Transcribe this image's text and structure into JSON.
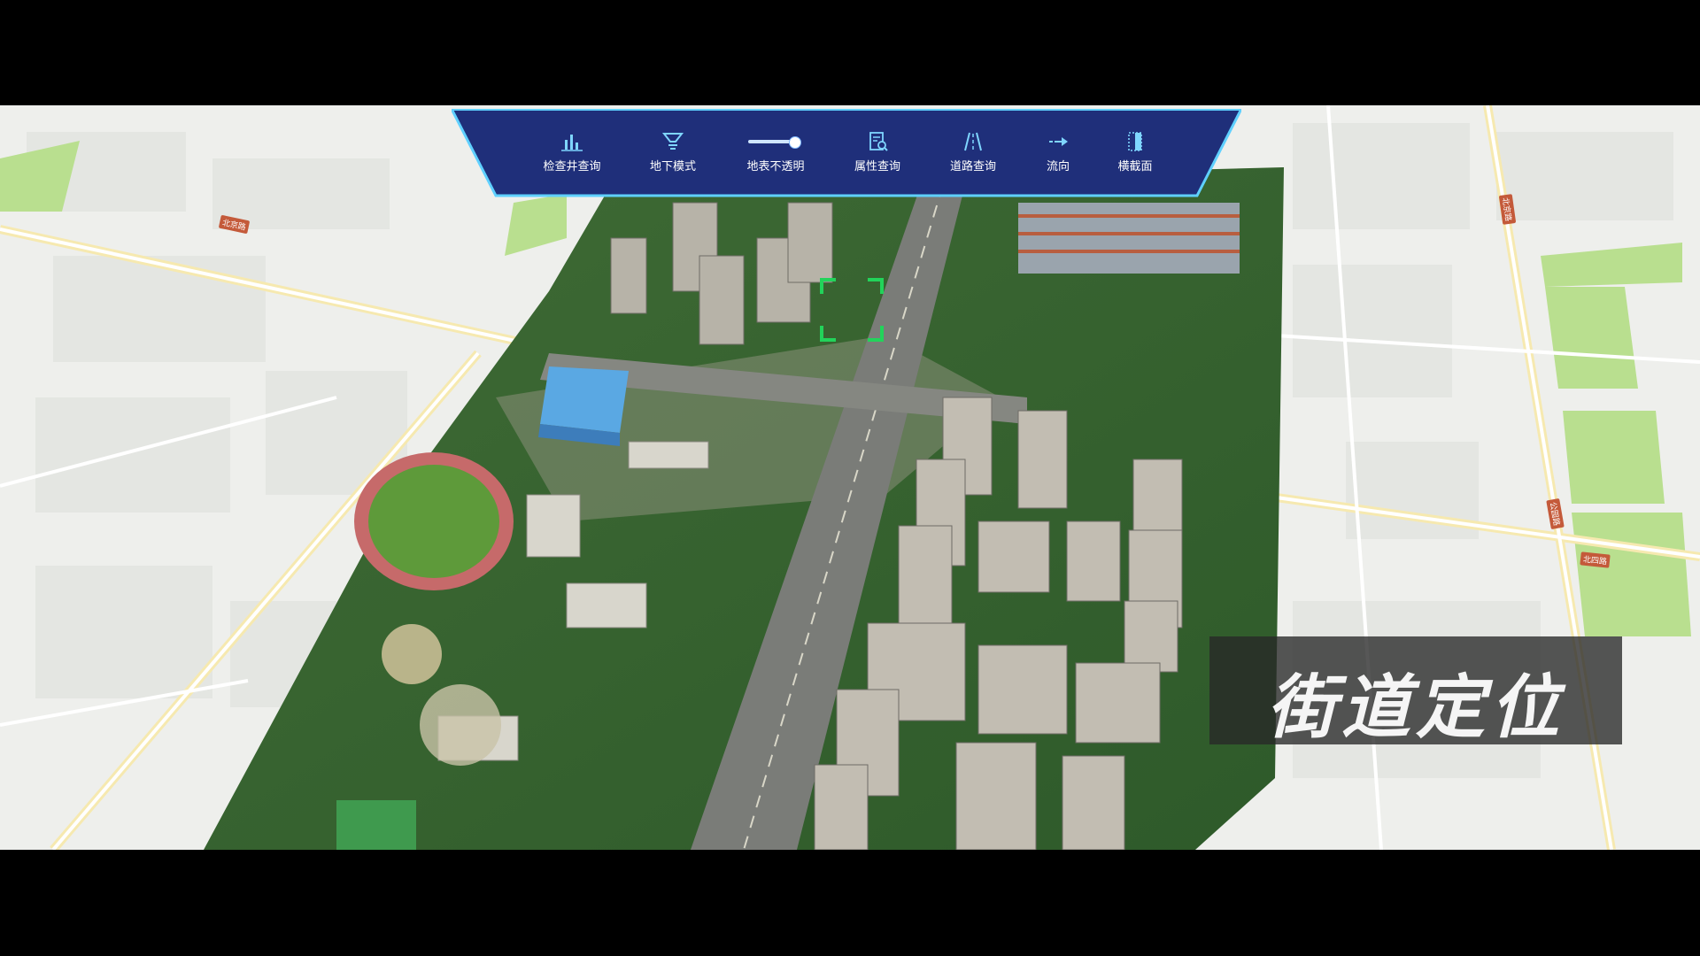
{
  "toolbar": {
    "items": [
      {
        "label": "检查井查询",
        "icon": "bar-chart-icon"
      },
      {
        "label": "地下模式",
        "icon": "funnel-icon"
      },
      {
        "label": "地表不透明",
        "icon": "slider-icon"
      },
      {
        "label": "属性查询",
        "icon": "document-search-icon"
      },
      {
        "label": "道路查询",
        "icon": "road-icon"
      },
      {
        "label": "流向",
        "icon": "arrow-right-icon"
      },
      {
        "label": "横截面",
        "icon": "cross-section-icon"
      }
    ],
    "opacity_slider_value": 0.9,
    "colors": {
      "background": "#1f2f7a",
      "border": "#5fd0ff"
    }
  },
  "map": {
    "road_labels": [
      "北京路",
      "北京路",
      "公园路",
      "北四路"
    ]
  },
  "caption": {
    "text": "街道定位"
  },
  "colors": {
    "reticle": "#22d35a"
  }
}
